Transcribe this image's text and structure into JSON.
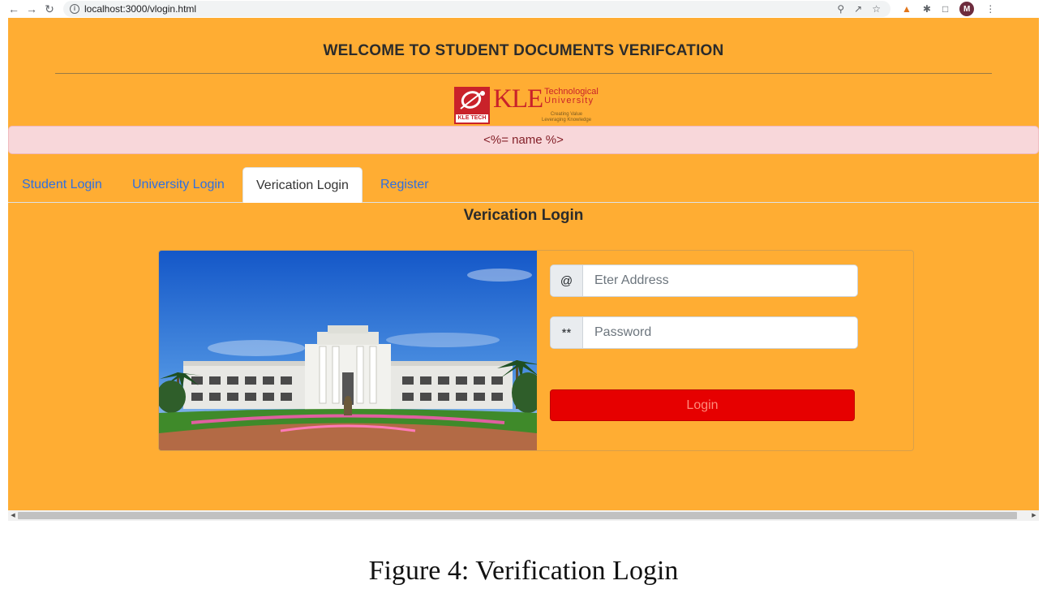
{
  "browser": {
    "url": "localhost:3000/vlogin.html",
    "avatar_initial": "M"
  },
  "header": {
    "title": "WELCOME TO STUDENT DOCUMENTS VERIFCATION"
  },
  "logo": {
    "brand": "KLE",
    "line1": "Technological",
    "line2": "University",
    "badge": "KLE TECH",
    "tagline1": "Creating Value",
    "tagline2": "Leveraging Knowledge"
  },
  "alert": {
    "text": "<%= name %>"
  },
  "tabs": [
    {
      "label": "Student Login",
      "active": false
    },
    {
      "label": "University Login",
      "active": false
    },
    {
      "label": "Verication Login",
      "active": true
    },
    {
      "label": "Register",
      "active": false
    }
  ],
  "form": {
    "heading": "Verication Login",
    "email_addon": "@",
    "email_placeholder": "Eter Address",
    "password_addon": "**",
    "password_placeholder": "Password",
    "submit_label": "Login"
  },
  "caption": "Figure 4: Verification Login",
  "colors": {
    "page_bg": "#ffad33",
    "alert_bg": "#f8d7da",
    "alert_text": "#842029",
    "tab_link": "#2e6fe0",
    "login_button": "#e60000"
  },
  "icons": [
    "back-arrow-icon",
    "forward-arrow-icon",
    "reload-icon",
    "info-icon",
    "zoom-icon",
    "share-icon",
    "star-icon",
    "metamask-icon",
    "puzzle-icon",
    "sidepanel-icon",
    "menu-dots-icon"
  ]
}
